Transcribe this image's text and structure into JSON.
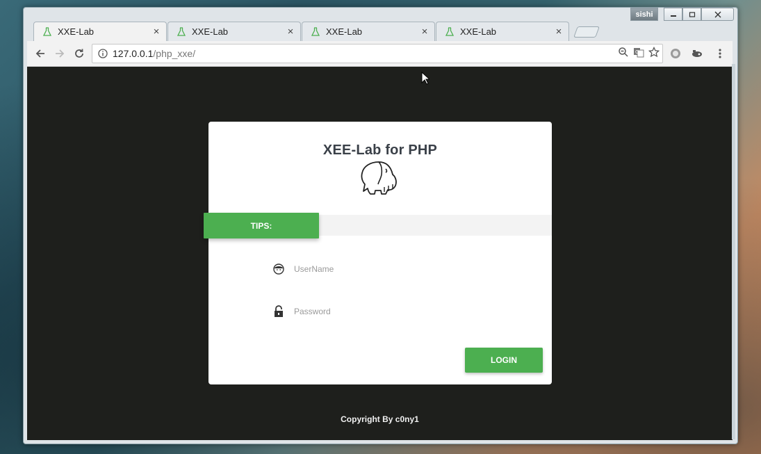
{
  "browser": {
    "tabs": [
      {
        "title": "XXE-Lab",
        "close": "×"
      },
      {
        "title": "XXE-Lab",
        "close": "×"
      },
      {
        "title": "XXE-Lab",
        "close": "×"
      },
      {
        "title": "XXE-Lab",
        "close": "×"
      }
    ],
    "user_badge": "sishi",
    "url_host": "127.0.0.1",
    "url_path": "/php_xxe/"
  },
  "page": {
    "title": "XEE-Lab for PHP",
    "tips_label": "TIPS:",
    "username_placeholder": "UserName",
    "password_placeholder": "Password",
    "login_label": "LOGIN",
    "footer": "Copyright By c0ny1"
  },
  "colors": {
    "accent": "#4caf50",
    "page_bg": "#1e1f1c",
    "card_bg": "#ffffff",
    "title_text": "#3a4048"
  },
  "icons": {
    "tab": "flask-icon",
    "back": "arrow-left-icon",
    "forward": "arrow-right-icon",
    "reload": "reload-icon",
    "info": "info-icon",
    "zoom": "zoom-out-icon",
    "translate": "translate-icon",
    "bookmark": "star-icon",
    "username": "user-face-icon",
    "password": "lock-icon",
    "logo": "elephant-icon"
  }
}
